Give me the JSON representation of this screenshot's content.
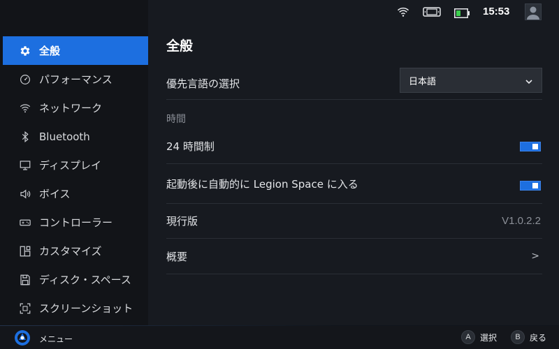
{
  "sidebar": {
    "items": [
      {
        "label": "全般",
        "icon": "gear-icon",
        "active": true
      },
      {
        "label": "パフォーマンス",
        "icon": "speedometer-icon",
        "active": false
      },
      {
        "label": "ネットワーク",
        "icon": "wifi-icon",
        "active": false
      },
      {
        "label": "Bluetooth",
        "icon": "bluetooth-icon",
        "active": false
      },
      {
        "label": "ディスプレイ",
        "icon": "monitor-icon",
        "active": false
      },
      {
        "label": "ボイス",
        "icon": "speaker-icon",
        "active": false
      },
      {
        "label": "コントローラー",
        "icon": "gamepad-icon",
        "active": false
      },
      {
        "label": "カスタマイズ",
        "icon": "customize-icon",
        "active": false
      },
      {
        "label": "ディスク・スペース",
        "icon": "disk-icon",
        "active": false
      },
      {
        "label": "スクリーンショット",
        "icon": "screenshot-icon",
        "active": false
      }
    ]
  },
  "status": {
    "time": "15:53",
    "icons": [
      "wifi-icon",
      "controller-icon",
      "battery-icon",
      "user-avatar-icon"
    ]
  },
  "main": {
    "title": "全般",
    "language": {
      "label": "優先言語の選択",
      "value": "日本語"
    },
    "time_section": "時間",
    "clock24": {
      "label": "24 時間制",
      "enabled": true
    },
    "autostart": {
      "label": "起動後に自動的に Legion Space に入る",
      "enabled": true
    },
    "version": {
      "label": "現行版",
      "value": "V1.0.2.2"
    },
    "about": {
      "label": "概要",
      "chevron": ">"
    }
  },
  "bottom": {
    "menu_label": "メニュー",
    "hints": [
      {
        "button": "A",
        "label": "選択"
      },
      {
        "button": "B",
        "label": "戻る"
      }
    ]
  },
  "colors": {
    "accent": "#1d6fe0",
    "background": "#171a20",
    "sidebar": "#121418"
  }
}
